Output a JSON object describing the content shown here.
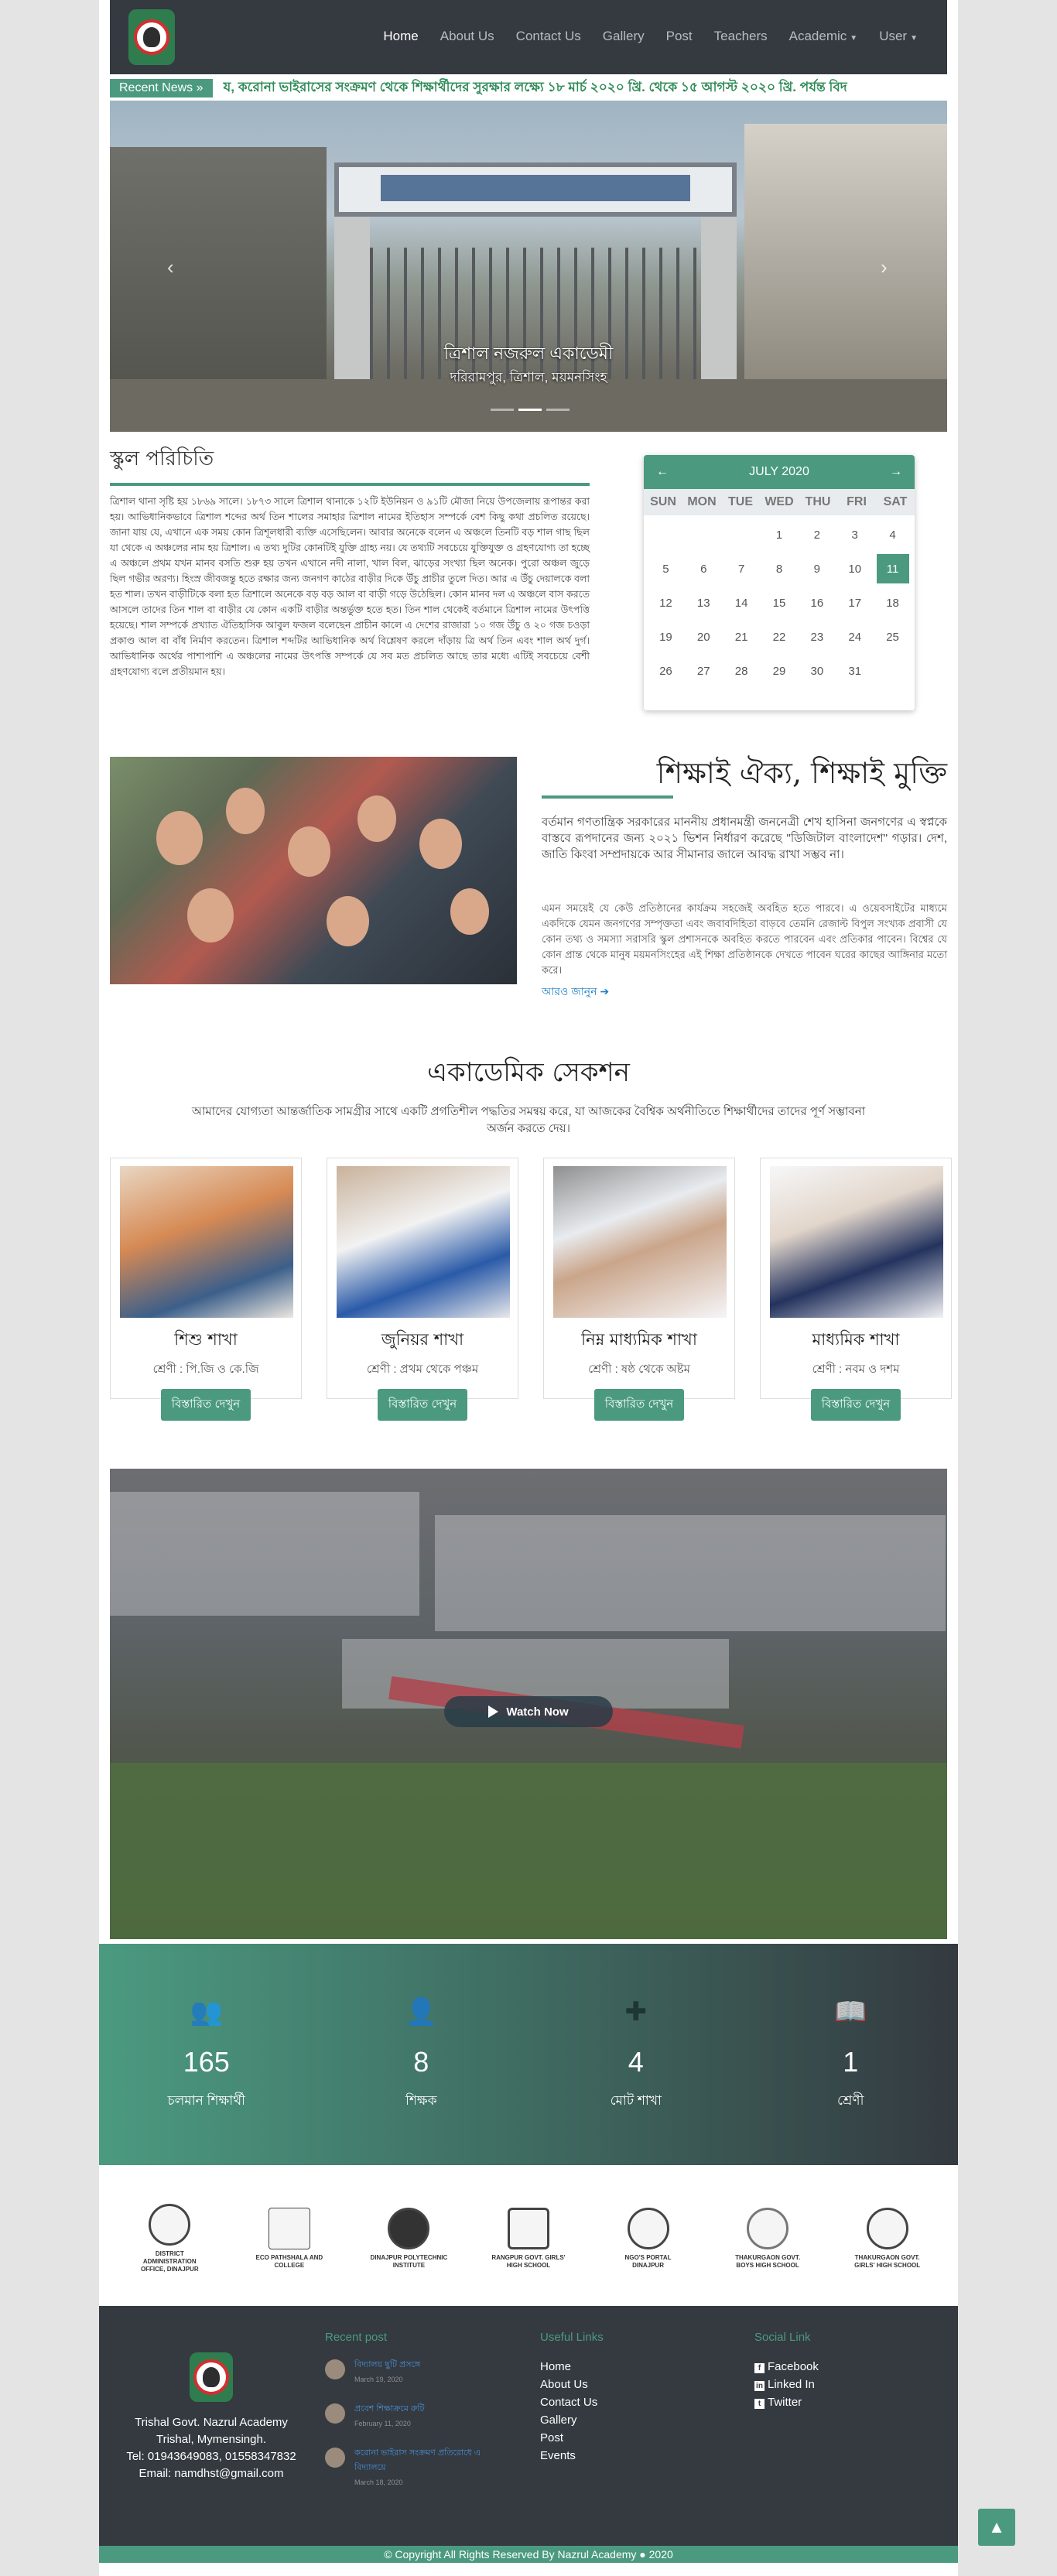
{
  "nav": {
    "items": [
      "Home",
      "About Us",
      "Contact Us",
      "Gallery",
      "Post",
      "Teachers",
      "Academic",
      "User"
    ]
  },
  "news": {
    "badge": "Recent News",
    "text": "য, করোনা ভাইরাসের সংক্রমণ থেকে শিক্ষার্থীদের সুরক্ষার লক্ষ্যে ১৮ মার্চ ২০২০ খ্রি. থেকে ১৫ আগস্ট ২০২০ খ্রি. পর্যন্ত বিদ"
  },
  "hero": {
    "caption": "ত্রিশাল নজরুল একাডেমী",
    "subcaption": "দরিরামপুর, ত্রিশাল, ময়মনসিংহ"
  },
  "intro": {
    "title": "স্কুল পরিচিতি",
    "text": "ত্রিশাল থানা সৃষ্টি হয় ১৮৬৯ সালে। ১৮৭৩ সালে ত্রিশাল থানাকে ১২টি ইউনিয়ন ও ৯১টি মৌজা নিয়ে উপজেলায় রূপান্তর করা হয়। আভিধানিকভাবে ত্রিশাল শব্দের অর্থ তিন শালের সমাহার ত্রিশাল নামের ইতিহাস সম্পর্কে বেশ কিছু কথা প্রচলিত রয়েছে। জানা যায় যে, এখানে এক সময় কোন ত্রিশূলধারী ব্যক্তি এসেছিলেন। আবার অনেকে বলেন এ অঞ্চলে তিনটি বড় শাল গাছ ছিল যা থেকে এ অঞ্চলের নাম হয় ত্রিশাল। এ তথ্য দুটির কোনটিই যুক্তি গ্রাহ্য নয়। যে তথ্যটি সবচেয়ে যুক্তিযুক্ত ও গ্রহণযোগ্য তা হচ্ছে এ অঞ্চলে প্রথম যখন মানব বসতি শুরু হয় তখন এখানে নদী নালা, খাল বিল, ঝাড়ের সংখ্যা ছিল অনেক। পুরো অঞ্চল জুড়ে ছিল গভীর অরণ্য। হিংস্র জীবজন্তু হতে রক্ষার জন্য জনগণ কাঠের বাড়ীর দিকে উঁচু প্রাচীর তুলে দিত। আর এ উঁচু দেয়ালকে বলা হত শাল। তখন বাড়ীটিকে বলা হত ত্রিশালে অনেকে বড় বড় আল বা বাড়ী গড়ে উঠেছিল। কোন মানব দল এ অঞ্চলে বাস করতে আসলে তাদের তিন শাল বা বাড়ীর যে কোন একটি বাড়ীর অন্তর্ভুক্ত হতে হত। তিন শাল থেকেই বর্তমানে ত্রিশাল নামের উৎপত্তি হয়েছে। শাল সম্পর্কে প্রখ্যাত ঐতিহাসিক আবুল ফজল বলেছেন প্রাচীন কালে এ দেশের রাজারা ১০ গজ উঁচু ও ২০ গজ চওড়া প্রকাণ্ড আল বা বাঁধ নির্মাণ করতেন। ত্রিশাল শব্দটির আভিধানিক অর্থ বিশ্লেষণ করলে দাঁড়ায় ত্রি অর্থ তিন এবং শাল অর্থ দুর্গ। আভিধানিক অর্থের পাশাপাশি এ অঞ্চলের নামের উৎপত্তি সম্পর্কে যে সব মত প্রচলিত আছে তার মধ্যে এটিই সবচেয়ে বেশী গ্রহণযোগ্য বলে প্রতীয়মান হয়।"
  },
  "calendar": {
    "month": "JULY 2020",
    "weekdays": [
      "SUN",
      "MON",
      "TUE",
      "WED",
      "THU",
      "FRI",
      "SAT"
    ],
    "days": [
      "",
      "",
      "",
      "1",
      "2",
      "3",
      "4",
      "5",
      "6",
      "7",
      "8",
      "9",
      "10",
      "11",
      "12",
      "13",
      "14",
      "15",
      "16",
      "17",
      "18",
      "19",
      "20",
      "21",
      "22",
      "23",
      "24",
      "25",
      "26",
      "27",
      "28",
      "29",
      "30",
      "31",
      ""
    ],
    "today": "11",
    "accent": "#4b9a80"
  },
  "unity": {
    "title": "শিক্ষাই ঐক্য, শিক্ষাই মুক্তি",
    "p1": "বর্তমান গণতান্ত্রিক সরকারের মাননীয় প্রধানমন্ত্রী জননেত্রী শেখ হাসিনা জনগণের এ স্বপ্নকে বাস্তবে রূপদানের জন্য ২০২১ ভিশন নির্ধারণ করেছে \"ডিজিটাল বাংলাদেশ\" গড়ার। দেশ, জাতি কিংবা সম্প্রদায়কে আর সীমানার জালে আবদ্ধ রাখা সম্ভব না।",
    "p2": "এমন সময়েই যে কেউ প্রতিষ্ঠানের কার্যক্রম সহজেই অবহিত হতে পারবে। এ ওয়েবসাইটের মাধ্যমে একদিকে যেমন জনগণের সম্পৃক্ততা এবং জবাবদিহিতা বাড়বে তেমনি রেজাল্ট বিপুল সংখ্যক প্রবাসী যে কোন তথ্য ও সমস্যা সরাসরি স্কুল প্রশাসনকে অবহিত করতে পারবেন এবং প্রতিকার পাবেন। বিশ্বের যে কোন প্রান্ত থেকে মানুষ ময়মনসিংহের এই শিক্ষা প্রতিষ্ঠানকে দেখতে পাবেন ঘরের কাছের আঙ্গিনার মতো করে।",
    "more": "আরও জানুন"
  },
  "academic": {
    "title": "একাডেমিক সেকশন",
    "subtitle": "আমাদের যোগ্যতা আন্তর্জাতিক সামগ্রীর সাথে একটি প্রগতিশীল পদ্ধতির সমন্বয় করে, যা আজকের বৈশ্বিক অর্থনীতিতে শিক্ষার্থীদের তাদের পূর্ণ সম্ভাবনা অর্জন করতে দেয়।",
    "cards": [
      {
        "name": "শিশু শাখা",
        "class": "শ্রেণী : পি.জি ও কে.জি",
        "button": "বিস্তারিত দেখুন"
      },
      {
        "name": "জুনিয়র শাখা",
        "class": "শ্রেণী : প্রথম থেকে পঞ্চম",
        "button": "বিস্তারিত দেখুন"
      },
      {
        "name": "নিম্ন মাধ্যমিক শাখা",
        "class": "শ্রেণী : ষষ্ঠ থেকে অষ্টম",
        "button": "বিস্তারিত দেখুন"
      },
      {
        "name": "মাধ্যমিক শাখা",
        "class": "শ্রেণী : নবম ও দশম",
        "button": "বিস্তারিত দেখুন"
      }
    ]
  },
  "video": {
    "button": "Watch Now"
  },
  "stats": [
    {
      "icon": "users-icon",
      "value": "165",
      "label": "চলমান শিক্ষার্থী"
    },
    {
      "icon": "teacher-icon",
      "value": "8",
      "label": "শিক্ষক"
    },
    {
      "icon": "puzzle-icon",
      "value": "4",
      "label": "মোট শাখা"
    },
    {
      "icon": "book-icon",
      "value": "1",
      "label": "শ্রেণী"
    }
  ],
  "partners": [
    "DISTRICT ADMINISTRATION OFFICE, DINAJPUR",
    "ECO PATHSHALA AND COLLEGE",
    "DINAJPUR POLYTECHNIC INSTITUTE",
    "RANGPUR GOVT. GIRLS' HIGH SCHOOL",
    "NGO'S PORTAL DINAJPUR",
    "THAKURGAON GOVT. BOYS HIGH SCHOOL",
    "THAKURGAON GOVT. GIRLS' HIGH SCHOOL"
  ],
  "footer": {
    "brand_lines": [
      "Trishal Govt. Nazrul Academy",
      "Trishal, Mymensingh.",
      "Tel: 01943649083, 01558347832",
      "Email: namdhst@gmail.com"
    ],
    "recent_title": "Recent post",
    "posts": [
      {
        "title": "বিদ্যালয় ছুটি প্রসঙ্গে",
        "date": "March 19, 2020"
      },
      {
        "title": "প্রবেশ শিক্ষাক্রমে রুটি",
        "date": "February 11, 2020"
      },
      {
        "title": "করোনা ভাইরাস সংক্রমণ প্রতিরোধে এ বিদ্যালয়ে",
        "date": "March 18, 2020"
      }
    ],
    "useful_title": "Useful Links",
    "links": [
      "Home",
      "About Us",
      "Contact Us",
      "Gallery",
      "Post",
      "Events"
    ],
    "social_title": "Social Link",
    "social": [
      {
        "icon": "facebook-icon",
        "label": "Facebook"
      },
      {
        "icon": "linkedin-icon",
        "label": "Linked In"
      },
      {
        "icon": "twitter-icon",
        "label": "Twitter"
      }
    ]
  },
  "copyright": "© Copyright All Rights Reserved By Nazrul Academy ● 2020"
}
